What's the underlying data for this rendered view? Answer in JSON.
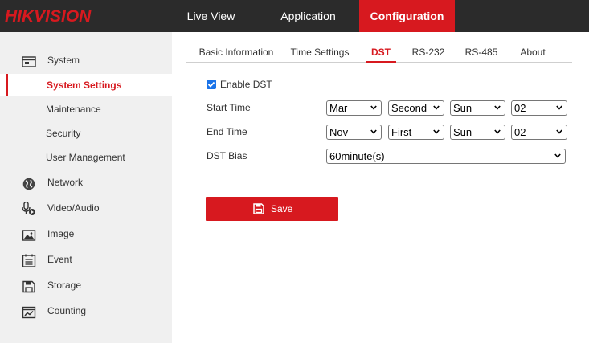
{
  "header": {
    "logo_text": "HIKVISION",
    "nav": [
      {
        "label": "Live View",
        "active": false
      },
      {
        "label": "Application",
        "active": false
      },
      {
        "label": "Configuration",
        "active": true
      }
    ]
  },
  "sidebar": {
    "items": [
      {
        "label": "System",
        "icon": "system-icon"
      },
      {
        "label": "System Settings",
        "active": true
      },
      {
        "label": "Maintenance"
      },
      {
        "label": "Security"
      },
      {
        "label": "User Management"
      },
      {
        "label": "Network",
        "icon": "globe-icon"
      },
      {
        "label": "Video/Audio",
        "icon": "microphone-icon"
      },
      {
        "label": "Image",
        "icon": "image-icon"
      },
      {
        "label": "Event",
        "icon": "event-list-icon"
      },
      {
        "label": "Storage",
        "icon": "storage-icon"
      },
      {
        "label": "Counting",
        "icon": "counting-chart-icon"
      }
    ]
  },
  "tabs": [
    {
      "label": "Basic Information"
    },
    {
      "label": "Time Settings"
    },
    {
      "label": "DST",
      "active": true
    },
    {
      "label": "RS-232"
    },
    {
      "label": "RS-485"
    },
    {
      "label": "About"
    }
  ],
  "form": {
    "enable_dst": {
      "label": "Enable DST",
      "checked": true
    },
    "start_time": {
      "label": "Start Time",
      "month": "Mar",
      "week": "Second",
      "day": "Sun",
      "hour": "02"
    },
    "end_time": {
      "label": "End Time",
      "month": "Nov",
      "week": "First",
      "day": "Sun",
      "hour": "02"
    },
    "dst_bias": {
      "label": "DST Bias",
      "value": "60minute(s)"
    },
    "save_label": "Save"
  },
  "colors": {
    "accent": "#d7191f",
    "topbar": "#2b2b2b",
    "sidebar": "#f0f0f0",
    "checkbox": "#1a73e8"
  }
}
